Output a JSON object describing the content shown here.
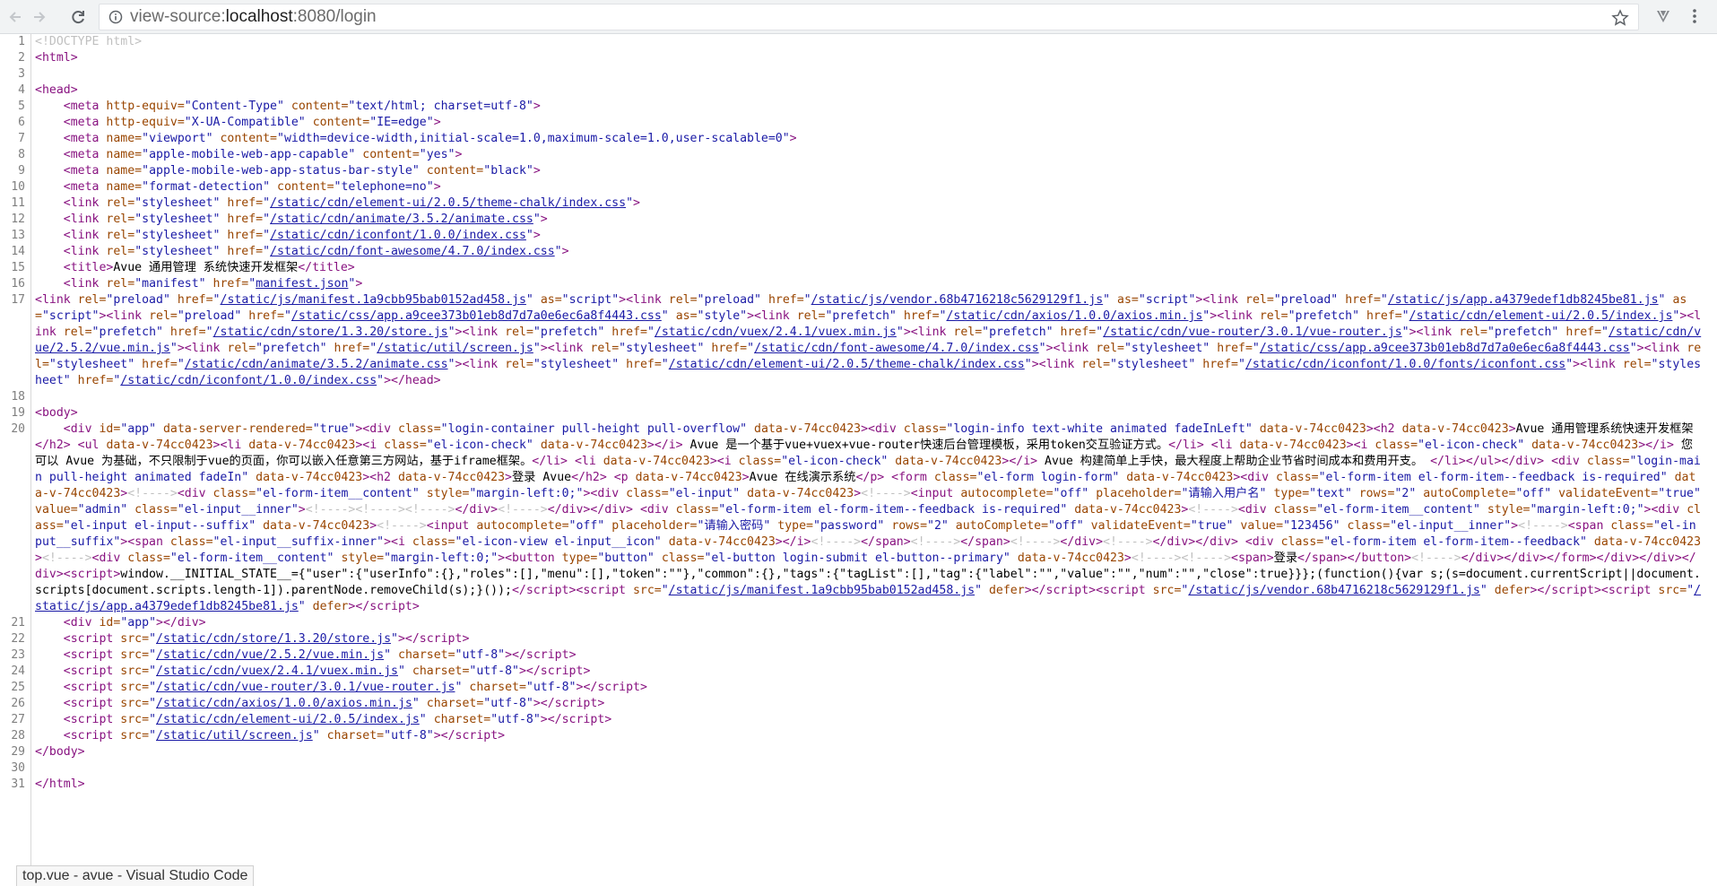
{
  "browser": {
    "url_prefix": "view-source:",
    "url_host": "localhost",
    "url_rest": ":8080/login"
  },
  "statusbar": {
    "text": "top.vue - avue - Visual Studio Code"
  },
  "source_lines": [
    {
      "n": "1",
      "html": "<span class=\"doc\">&lt;!DOCTYPE html&gt;</span>"
    },
    {
      "n": "2",
      "html": "<span class=\"tag\">&lt;html&gt;</span>"
    },
    {
      "n": "3",
      "html": ""
    },
    {
      "n": "4",
      "html": "<span class=\"tag\">&lt;head&gt;</span>"
    },
    {
      "n": "5",
      "html": "    <span class=\"tag\">&lt;meta</span> <span class=\"attr\">http-equiv=</span><span class=\"val\">\"Content-Type\"</span> <span class=\"attr\">content=</span><span class=\"val\">\"text/html; charset=utf-8\"</span><span class=\"tag\">&gt;</span>"
    },
    {
      "n": "6",
      "html": "    <span class=\"tag\">&lt;meta</span> <span class=\"attr\">http-equiv=</span><span class=\"val\">\"X-UA-Compatible\"</span> <span class=\"attr\">content=</span><span class=\"val\">\"IE=edge\"</span><span class=\"tag\">&gt;</span>"
    },
    {
      "n": "7",
      "html": "    <span class=\"tag\">&lt;meta</span> <span class=\"attr\">name=</span><span class=\"val\">\"viewport\"</span> <span class=\"attr\">content=</span><span class=\"val\">\"width=device-width,initial-scale=1.0,maximum-scale=1.0,user-scalable=0\"</span><span class=\"tag\">&gt;</span>"
    },
    {
      "n": "8",
      "html": "    <span class=\"tag\">&lt;meta</span> <span class=\"attr\">name=</span><span class=\"val\">\"apple-mobile-web-app-capable\"</span> <span class=\"attr\">content=</span><span class=\"val\">\"yes\"</span><span class=\"tag\">&gt;</span>"
    },
    {
      "n": "9",
      "html": "    <span class=\"tag\">&lt;meta</span> <span class=\"attr\">name=</span><span class=\"val\">\"apple-mobile-web-app-status-bar-style\"</span> <span class=\"attr\">content=</span><span class=\"val\">\"black\"</span><span class=\"tag\">&gt;</span>"
    },
    {
      "n": "10",
      "html": "    <span class=\"tag\">&lt;meta</span> <span class=\"attr\">name=</span><span class=\"val\">\"format-detection\"</span> <span class=\"attr\">content=</span><span class=\"val\">\"telephone=no\"</span><span class=\"tag\">&gt;</span>"
    },
    {
      "n": "11",
      "html": "    <span class=\"tag\">&lt;link</span> <span class=\"attr\">rel=</span><span class=\"val\">\"stylesheet\"</span> <span class=\"attr\">href=</span><span class=\"val\">\"<span class=\"link\">/static/cdn/element-ui/2.0.5/theme-chalk/index.css</span>\"</span><span class=\"tag\">&gt;</span>"
    },
    {
      "n": "12",
      "html": "    <span class=\"tag\">&lt;link</span> <span class=\"attr\">rel=</span><span class=\"val\">\"stylesheet\"</span> <span class=\"attr\">href=</span><span class=\"val\">\"<span class=\"link\">/static/cdn/animate/3.5.2/animate.css</span>\"</span><span class=\"tag\">&gt;</span>"
    },
    {
      "n": "13",
      "html": "    <span class=\"tag\">&lt;link</span> <span class=\"attr\">rel=</span><span class=\"val\">\"stylesheet\"</span> <span class=\"attr\">href=</span><span class=\"val\">\"<span class=\"link\">/static/cdn/iconfont/1.0.0/index.css</span>\"</span><span class=\"tag\">&gt;</span>"
    },
    {
      "n": "14",
      "html": "    <span class=\"tag\">&lt;link</span> <span class=\"attr\">rel=</span><span class=\"val\">\"stylesheet\"</span> <span class=\"attr\">href=</span><span class=\"val\">\"<span class=\"link\">/static/cdn/font-awesome/4.7.0/index.css</span>\"</span><span class=\"tag\">&gt;</span>"
    },
    {
      "n": "15",
      "html": "    <span class=\"tag\">&lt;title&gt;</span>Avue 通用管理 系统快速开发框架<span class=\"tag\">&lt;/title&gt;</span>"
    },
    {
      "n": "16",
      "html": "    <span class=\"tag\">&lt;link</span> <span class=\"attr\">rel=</span><span class=\"val\">\"manifest\"</span> <span class=\"attr\">href=</span><span class=\"val\">\"<span class=\"link\">manifest.json</span>\"</span><span class=\"tag\">&gt;</span>"
    },
    {
      "n": "17",
      "wrap": true,
      "html": "<span class=\"tag\">&lt;link</span> <span class=\"attr\">rel=</span><span class=\"val\">\"preload\"</span> <span class=\"attr\">href=</span><span class=\"val\">\"<span class=\"link\">/static/js/manifest.1a9cbb95bab0152ad458.js</span>\"</span> <span class=\"attr\">as=</span><span class=\"val\">\"script\"</span><span class=\"tag\">&gt;&lt;link</span> <span class=\"attr\">rel=</span><span class=\"val\">\"preload\"</span> <span class=\"attr\">href=</span><span class=\"val\">\"<span class=\"link\">/static/js/vendor.68b4716218c5629129f1.js</span>\"</span> <span class=\"attr\">as=</span><span class=\"val\">\"script\"</span><span class=\"tag\">&gt;&lt;link</span> <span class=\"attr\">rel=</span><span class=\"val\">\"preload\"</span> <span class=\"attr\">href=</span><span class=\"val\">\"<span class=\"link\">/static/js/app.a4379edef1db8245be81.js</span>\"</span> <span class=\"attr\">as=</span><span class=\"val\">\"script\"</span><span class=\"tag\">&gt;&lt;link</span> <span class=\"attr\">rel=</span><span class=\"val\">\"preload\"</span> <span class=\"attr\">href=</span><span class=\"val\">\"<span class=\"link\">/static/css/app.a9cee373b01eb8d7d7a0e6ec6a8f4443.css</span>\"</span> <span class=\"attr\">as=</span><span class=\"val\">\"style\"</span><span class=\"tag\">&gt;&lt;link</span> <span class=\"attr\">rel=</span><span class=\"val\">\"prefetch\"</span> <span class=\"attr\">href=</span><span class=\"val\">\"<span class=\"link\">/static/cdn/axios/1.0.0/axios.min.js</span>\"</span><span class=\"tag\">&gt;&lt;link</span> <span class=\"attr\">rel=</span><span class=\"val\">\"prefetch\"</span> <span class=\"attr\">href=</span><span class=\"val\">\"<span class=\"link\">/static/cdn/element-ui/2.0.5/index.js</span>\"</span><span class=\"tag\">&gt;&lt;link</span> <span class=\"attr\">rel=</span><span class=\"val\">\"prefetch\"</span> <span class=\"attr\">href=</span><span class=\"val\">\"<span class=\"link\">/static/cdn/store/1.3.20/store.js</span>\"</span><span class=\"tag\">&gt;&lt;link</span> <span class=\"attr\">rel=</span><span class=\"val\">\"prefetch\"</span> <span class=\"attr\">href=</span><span class=\"val\">\"<span class=\"link\">/static/cdn/vuex/2.4.1/vuex.min.js</span>\"</span><span class=\"tag\">&gt;&lt;link</span> <span class=\"attr\">rel=</span><span class=\"val\">\"prefetch\"</span> <span class=\"attr\">href=</span><span class=\"val\">\"<span class=\"link\">/static/cdn/vue-router/3.0.1/vue-router.js</span>\"</span><span class=\"tag\">&gt;&lt;link</span> <span class=\"attr\">rel=</span><span class=\"val\">\"prefetch\"</span> <span class=\"attr\">href=</span><span class=\"val\">\"<span class=\"link\">/static/cdn/vue/2.5.2/vue.min.js</span>\"</span><span class=\"tag\">&gt;&lt;link</span> <span class=\"attr\">rel=</span><span class=\"val\">\"prefetch\"</span> <span class=\"attr\">href=</span><span class=\"val\">\"<span class=\"link\">/static/util/screen.js</span>\"</span><span class=\"tag\">&gt;&lt;link</span> <span class=\"attr\">rel=</span><span class=\"val\">\"stylesheet\"</span> <span class=\"attr\">href=</span><span class=\"val\">\"<span class=\"link\">/static/cdn/font-awesome/4.7.0/index.css</span>\"</span><span class=\"tag\">&gt;&lt;link</span> <span class=\"attr\">rel=</span><span class=\"val\">\"stylesheet\"</span> <span class=\"attr\">href=</span><span class=\"val\">\"<span class=\"link\">/static/css/app.a9cee373b01eb8d7d7a0e6ec6a8f4443.css</span>\"</span><span class=\"tag\">&gt;&lt;link</span> <span class=\"attr\">rel=</span><span class=\"val\">\"stylesheet\"</span> <span class=\"attr\">href=</span><span class=\"val\">\"<span class=\"link\">/static/cdn/animate/3.5.2/animate.css</span>\"</span><span class=\"tag\">&gt;&lt;link</span> <span class=\"attr\">rel=</span><span class=\"val\">\"stylesheet\"</span> <span class=\"attr\">href=</span><span class=\"val\">\"<span class=\"link\">/static/cdn/element-ui/2.0.5/theme-chalk/index.css</span>\"</span><span class=\"tag\">&gt;&lt;link</span> <span class=\"attr\">rel=</span><span class=\"val\">\"stylesheet\"</span> <span class=\"attr\">href=</span><span class=\"val\">\"<span class=\"link\">/static/cdn/iconfont/1.0.0/fonts/iconfont.css</span>\"</span><span class=\"tag\">&gt;&lt;link</span> <span class=\"attr\">rel=</span><span class=\"val\">\"stylesheet\"</span> <span class=\"attr\">href=</span><span class=\"val\">\"<span class=\"link\">/static/cdn/iconfont/1.0.0/index.css</span>\"</span><span class=\"tag\">&gt;&lt;/head&gt;</span>"
    },
    {
      "n": "18",
      "html": ""
    },
    {
      "n": "19",
      "html": "<span class=\"tag\">&lt;body&gt;</span>"
    },
    {
      "n": "20",
      "wrap": true,
      "html": "    <span class=\"tag\">&lt;div</span> <span class=\"attr\">id=</span><span class=\"val\">\"app\"</span> <span class=\"attr\">data-server-rendered=</span><span class=\"val\">\"true\"</span><span class=\"tag\">&gt;&lt;div</span> <span class=\"attr\">class=</span><span class=\"val\">\"login-container pull-height pull-overflow\"</span> <span class=\"attr\">data-v-74cc0423</span><span class=\"tag\">&gt;&lt;div</span> <span class=\"attr\">class=</span><span class=\"val\">\"login-info text-white animated fadeInLeft\"</span> <span class=\"attr\">data-v-74cc0423</span><span class=\"tag\">&gt;&lt;h2</span> <span class=\"attr\">data-v-74cc0423</span><span class=\"tag\">&gt;</span>Avue 通用管理系统快速开发框架<span class=\"tag\">&lt;/h2&gt;</span> <span class=\"tag\">&lt;ul</span> <span class=\"attr\">data-v-74cc0423</span><span class=\"tag\">&gt;&lt;li</span> <span class=\"attr\">data-v-74cc0423</span><span class=\"tag\">&gt;&lt;i</span> <span class=\"attr\">class=</span><span class=\"val\">\"el-icon-check\"</span> <span class=\"attr\">data-v-74cc0423</span><span class=\"tag\">&gt;&lt;/i&gt;</span> Avue 是一个基于vue+vuex+vue-router快速后台管理模板，采用token交互验证方式。<span class=\"tag\">&lt;/li&gt;</span> <span class=\"tag\">&lt;li</span> <span class=\"attr\">data-v-74cc0423</span><span class=\"tag\">&gt;&lt;i</span> <span class=\"attr\">class=</span><span class=\"val\">\"el-icon-check\"</span> <span class=\"attr\">data-v-74cc0423</span><span class=\"tag\">&gt;&lt;/i&gt;</span> 您可以 Avue 为基础，不只限制于vue的页面，你可以嵌入任意第三方网站，基于iframe框架。<span class=\"tag\">&lt;/li&gt;</span> <span class=\"tag\">&lt;li</span> <span class=\"attr\">data-v-74cc0423</span><span class=\"tag\">&gt;&lt;i</span> <span class=\"attr\">class=</span><span class=\"val\">\"el-icon-check\"</span> <span class=\"attr\">data-v-74cc0423</span><span class=\"tag\">&gt;&lt;/i&gt;</span> Avue 构建简单上手快，最大程度上帮助企业节省时间成本和费用开支。 <span class=\"tag\">&lt;/li&gt;&lt;/ul&gt;&lt;/div&gt;</span> <span class=\"tag\">&lt;div</span> <span class=\"attr\">class=</span><span class=\"val\">\"login-main pull-height animated fadeIn\"</span> <span class=\"attr\">data-v-74cc0423</span><span class=\"tag\">&gt;&lt;h2</span> <span class=\"attr\">data-v-74cc0423</span><span class=\"tag\">&gt;</span>登录 Avue<span class=\"tag\">&lt;/h2&gt;</span> <span class=\"tag\">&lt;p</span> <span class=\"attr\">data-v-74cc0423</span><span class=\"tag\">&gt;</span>Avue 在线演示系统<span class=\"tag\">&lt;/p&gt;</span> <span class=\"tag\">&lt;form</span> <span class=\"attr\">class=</span><span class=\"val\">\"el-form login-form\"</span> <span class=\"attr\">data-v-74cc0423</span><span class=\"tag\">&gt;&lt;div</span> <span class=\"attr\">class=</span><span class=\"val\">\"el-form-item el-form-item--feedback is-required\"</span> <span class=\"attr\">data-v-74cc0423</span><span class=\"tag\">&gt;</span><span class=\"doc\">&lt;!----&gt;</span><span class=\"tag\">&lt;div</span> <span class=\"attr\">class=</span><span class=\"val\">\"el-form-item__content\"</span> <span class=\"attr\">style=</span><span class=\"val\">\"margin-left:0;\"</span><span class=\"tag\">&gt;&lt;div</span> <span class=\"attr\">class=</span><span class=\"val\">\"el-input\"</span> <span class=\"attr\">data-v-74cc0423</span><span class=\"tag\">&gt;</span><span class=\"doc\">&lt;!----&gt;</span><span class=\"tag\">&lt;input</span> <span class=\"attr\">autocomplete=</span><span class=\"val\">\"off\"</span> <span class=\"attr\">placeholder=</span><span class=\"val\">\"请输入用户名\"</span> <span class=\"attr\">type=</span><span class=\"val\">\"text\"</span> <span class=\"attr\">rows=</span><span class=\"val\">\"2\"</span> <span class=\"attr\">autoComplete=</span><span class=\"val\">\"off\"</span> <span class=\"attr\">validateEvent=</span><span class=\"val\">\"true\"</span> <span class=\"attr\">value=</span><span class=\"val\">\"admin\"</span> <span class=\"attr\">class=</span><span class=\"val\">\"el-input__inner\"</span><span class=\"tag\">&gt;</span><span class=\"doc\">&lt;!----&gt;&lt;!----&gt;&lt;!----&gt;</span><span class=\"tag\">&lt;/div&gt;</span><span class=\"doc\">&lt;!----&gt;</span><span class=\"tag\">&lt;/div&gt;&lt;/div&gt;</span> <span class=\"tag\">&lt;div</span> <span class=\"attr\">class=</span><span class=\"val\">\"el-form-item el-form-item--feedback is-required\"</span> <span class=\"attr\">data-v-74cc0423</span><span class=\"tag\">&gt;</span><span class=\"doc\">&lt;!----&gt;</span><span class=\"tag\">&lt;div</span> <span class=\"attr\">class=</span><span class=\"val\">\"el-form-item__content\"</span> <span class=\"attr\">style=</span><span class=\"val\">\"margin-left:0;\"</span><span class=\"tag\">&gt;&lt;div</span> <span class=\"attr\">class=</span><span class=\"val\">\"el-input el-input--suffix\"</span> <span class=\"attr\">data-v-74cc0423</span><span class=\"tag\">&gt;</span><span class=\"doc\">&lt;!----&gt;</span><span class=\"tag\">&lt;input</span> <span class=\"attr\">autocomplete=</span><span class=\"val\">\"off\"</span> <span class=\"attr\">placeholder=</span><span class=\"val\">\"请输入密码\"</span> <span class=\"attr\">type=</span><span class=\"val\">\"password\"</span> <span class=\"attr\">rows=</span><span class=\"val\">\"2\"</span> <span class=\"attr\">autoComplete=</span><span class=\"val\">\"off\"</span> <span class=\"attr\">validateEvent=</span><span class=\"val\">\"true\"</span> <span class=\"attr\">value=</span><span class=\"val\">\"123456\"</span> <span class=\"attr\">class=</span><span class=\"val\">\"el-input__inner\"</span><span class=\"tag\">&gt;</span><span class=\"doc\">&lt;!----&gt;</span><span class=\"tag\">&lt;span</span> <span class=\"attr\">class=</span><span class=\"val\">\"el-input__suffix\"</span><span class=\"tag\">&gt;&lt;span</span> <span class=\"attr\">class=</span><span class=\"val\">\"el-input__suffix-inner\"</span><span class=\"tag\">&gt;&lt;i</span> <span class=\"attr\">class=</span><span class=\"val\">\"el-icon-view el-input__icon\"</span> <span class=\"attr\">data-v-74cc0423</span><span class=\"tag\">&gt;&lt;/i&gt;</span><span class=\"doc\">&lt;!----&gt;</span><span class=\"tag\">&lt;/span&gt;</span><span class=\"doc\">&lt;!----&gt;</span><span class=\"tag\">&lt;/span&gt;</span><span class=\"doc\">&lt;!----&gt;</span><span class=\"tag\">&lt;/div&gt;</span><span class=\"doc\">&lt;!----&gt;</span><span class=\"tag\">&lt;/div&gt;&lt;/div&gt;</span> <span class=\"tag\">&lt;div</span> <span class=\"attr\">class=</span><span class=\"val\">\"el-form-item el-form-item--feedback\"</span> <span class=\"attr\">data-v-74cc0423</span><span class=\"tag\">&gt;</span><span class=\"doc\">&lt;!----&gt;</span><span class=\"tag\">&lt;div</span> <span class=\"attr\">class=</span><span class=\"val\">\"el-form-item__content\"</span> <span class=\"attr\">style=</span><span class=\"val\">\"margin-left:0;\"</span><span class=\"tag\">&gt;&lt;button</span> <span class=\"attr\">type=</span><span class=\"val\">\"button\"</span> <span class=\"attr\">class=</span><span class=\"val\">\"el-button login-submit el-button--primary\"</span> <span class=\"attr\">data-v-74cc0423</span><span class=\"tag\">&gt;</span><span class=\"doc\">&lt;!----&gt;&lt;!----&gt;</span><span class=\"tag\">&lt;span&gt;</span>登录<span class=\"tag\">&lt;/span&gt;&lt;/button&gt;</span><span class=\"doc\">&lt;!----&gt;</span><span class=\"tag\">&lt;/div&gt;&lt;/div&gt;&lt;/form&gt;&lt;/div&gt;&lt;/div&gt;&lt;/div&gt;&lt;script&gt;</span>window.__INITIAL_STATE__={\"user\":{\"userInfo\":{},\"roles\":[],\"menu\":[],\"token\":\"\"},\"common\":{},\"tags\":{\"tagList\":[],\"tag\":{\"label\":\"\",\"value\":\"\",\"num\":\"\",\"close\":true}}};(function(){var s;(s=document.currentScript||document.scripts[document.scripts.length-1]).parentNode.removeChild(s);}());<span class=\"tag\">&lt;/script&gt;&lt;script</span> <span class=\"attr\">src=</span><span class=\"val\">\"<span class=\"link\">/static/js/manifest.1a9cbb95bab0152ad458.js</span>\"</span> <span class=\"attr\">defer</span><span class=\"tag\">&gt;&lt;/script&gt;&lt;script</span> <span class=\"attr\">src=</span><span class=\"val\">\"<span class=\"link\">/static/js/vendor.68b4716218c5629129f1.js</span>\"</span> <span class=\"attr\">defer</span><span class=\"tag\">&gt;&lt;/script&gt;&lt;script</span> <span class=\"attr\">src=</span><span class=\"val\">\"<span class=\"link\">/static/js/app.a4379edef1db8245be81.js</span>\"</span> <span class=\"attr\">defer</span><span class=\"tag\">&gt;&lt;/script&gt;</span>"
    },
    {
      "n": "21",
      "html": "    <span class=\"tag\">&lt;div</span> <span class=\"attr\">id=</span><span class=\"val\">\"app\"</span><span class=\"tag\">&gt;&lt;/div&gt;</span>"
    },
    {
      "n": "22",
      "html": "    <span class=\"tag\">&lt;script</span> <span class=\"attr\">src=</span><span class=\"val\">\"<span class=\"link\">/static/cdn/store/1.3.20/store.js</span>\"</span><span class=\"tag\">&gt;&lt;/script&gt;</span>"
    },
    {
      "n": "23",
      "html": "    <span class=\"tag\">&lt;script</span> <span class=\"attr\">src=</span><span class=\"val\">\"<span class=\"link\">/static/cdn/vue/2.5.2/vue.min.js</span>\"</span> <span class=\"attr\">charset=</span><span class=\"val\">\"utf-8\"</span><span class=\"tag\">&gt;&lt;/script&gt;</span>"
    },
    {
      "n": "24",
      "html": "    <span class=\"tag\">&lt;script</span> <span class=\"attr\">src=</span><span class=\"val\">\"<span class=\"link\">/static/cdn/vuex/2.4.1/vuex.min.js</span>\"</span> <span class=\"attr\">charset=</span><span class=\"val\">\"utf-8\"</span><span class=\"tag\">&gt;&lt;/script&gt;</span>"
    },
    {
      "n": "25",
      "html": "    <span class=\"tag\">&lt;script</span> <span class=\"attr\">src=</span><span class=\"val\">\"<span class=\"link\">/static/cdn/vue-router/3.0.1/vue-router.js</span>\"</span> <span class=\"attr\">charset=</span><span class=\"val\">\"utf-8\"</span><span class=\"tag\">&gt;&lt;/script&gt;</span>"
    },
    {
      "n": "26",
      "html": "    <span class=\"tag\">&lt;script</span> <span class=\"attr\">src=</span><span class=\"val\">\"<span class=\"link\">/static/cdn/axios/1.0.0/axios.min.js</span>\"</span> <span class=\"attr\">charset=</span><span class=\"val\">\"utf-8\"</span><span class=\"tag\">&gt;&lt;/script&gt;</span>"
    },
    {
      "n": "27",
      "html": "    <span class=\"tag\">&lt;script</span> <span class=\"attr\">src=</span><span class=\"val\">\"<span class=\"link\">/static/cdn/element-ui/2.0.5/index.js</span>\"</span> <span class=\"attr\">charset=</span><span class=\"val\">\"utf-8\"</span><span class=\"tag\">&gt;&lt;/script&gt;</span>"
    },
    {
      "n": "28",
      "html": "    <span class=\"tag\">&lt;script</span> <span class=\"attr\">src=</span><span class=\"val\">\"<span class=\"link\">/static/util/screen.js</span>\"</span> <span class=\"attr\">charset=</span><span class=\"val\">\"utf-8\"</span><span class=\"tag\">&gt;&lt;/script&gt;</span>"
    },
    {
      "n": "29",
      "html": "<span class=\"tag\">&lt;/body&gt;</span>"
    },
    {
      "n": "30",
      "html": ""
    },
    {
      "n": "31",
      "html": "<span class=\"tag\">&lt;/html&gt;</span>"
    }
  ]
}
